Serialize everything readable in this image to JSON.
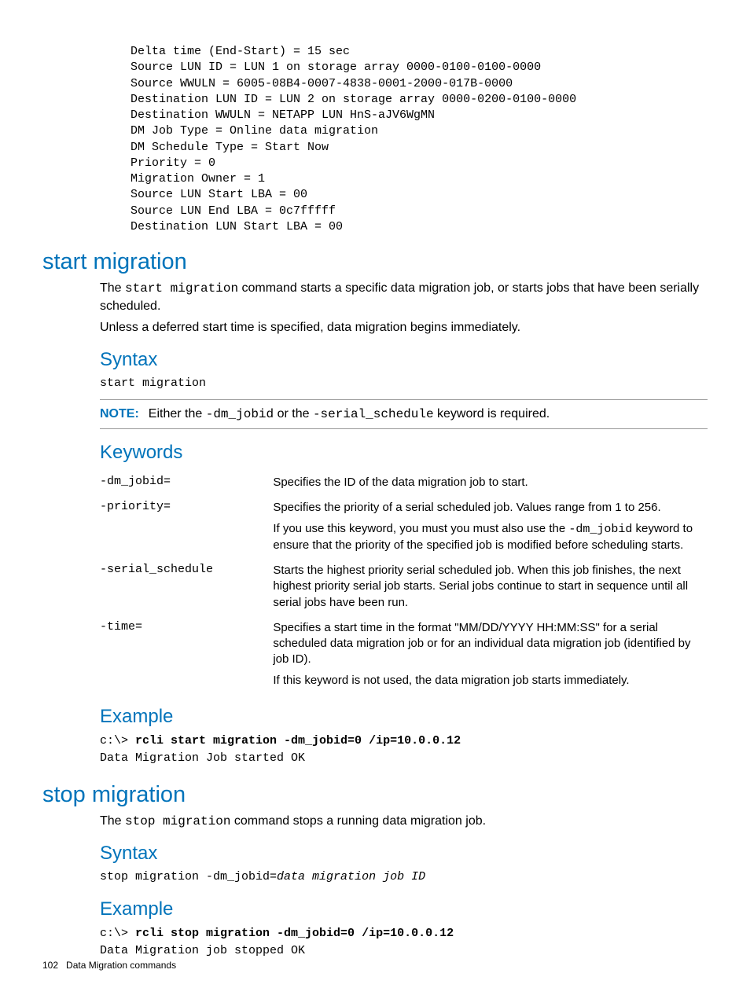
{
  "code_top": "Delta time (End-Start) = 15 sec\nSource LUN ID = LUN 1 on storage array 0000-0100-0100-0000\nSource WWULN = 6005-08B4-0007-4838-0001-2000-017B-0000\nDestination LUN ID = LUN 2 on storage array 0000-0200-0100-0000\nDestination WWULN = NETAPP LUN HnS-aJV6WgMN\nDM Job Type = Online data migration\nDM Schedule Type = Start Now\nPriority = 0\nMigration Owner = 1\nSource LUN Start LBA = 00\nSource LUN End LBA = 0c7fffff\nDestination LUN Start LBA = 00",
  "section1": {
    "title": "start migration",
    "desc1_a": "The ",
    "desc1_cmd": "start migration",
    "desc1_b": " command starts a specific data migration job, or starts jobs that have been serially scheduled.",
    "desc2": "Unless a deferred start time is specified, data migration begins immediately.",
    "syntax_h": "Syntax",
    "syntax": "start migration",
    "note_label": "NOTE:",
    "note_a": "Either the ",
    "note_c1": "-dm_jobid",
    "note_b": " or the ",
    "note_c2": "-serial_schedule",
    "note_c": " keyword is required.",
    "keywords_h": "Keywords",
    "kw": [
      {
        "k": "-dm_jobid=",
        "d": "Specifies the ID of the data migration job to start."
      },
      {
        "k": "-priority=",
        "d": "Specifies the priority of a serial scheduled job. Values range from 1 to 256.",
        "d2a": "If you use this keyword, you must you must also use the ",
        "d2cmd": "-dm_jobid",
        "d2b": " keyword to ensure that the priority of the specified job is modified before scheduling starts."
      },
      {
        "k": "-serial_schedule",
        "d": "Starts the highest priority serial scheduled job. When this job finishes, the next highest priority serial job starts. Serial jobs continue to start in sequence until all serial jobs have been run."
      },
      {
        "k": "-time=",
        "d": "Specifies a start time in the format \"MM/DD/YYYY HH:MM:SS\" for a serial scheduled data migration job or for an individual data migration job (identified by job ID).",
        "d2": "If this keyword is not used, the data migration job starts immediately."
      }
    ],
    "example_h": "Example",
    "ex_prompt": "c:\\> ",
    "ex_cmd": "rcli start migration -dm_jobid=0 /ip=10.0.0.12",
    "ex_out": "Data Migration Job started OK"
  },
  "section2": {
    "title": "stop migration",
    "desc_a": "The ",
    "desc_cmd": "stop migration",
    "desc_b": " command stops a running data migration job.",
    "syntax_h": "Syntax",
    "syntax_a": "stop migration -dm_jobid=",
    "syntax_b": "data migration job ID",
    "example_h": "Example",
    "ex_prompt": "c:\\> ",
    "ex_cmd": "rcli stop migration -dm_jobid=0 /ip=10.0.0.12",
    "ex_out": "Data Migration job stopped OK"
  },
  "footer": {
    "page": "102",
    "label": "Data Migration commands"
  }
}
